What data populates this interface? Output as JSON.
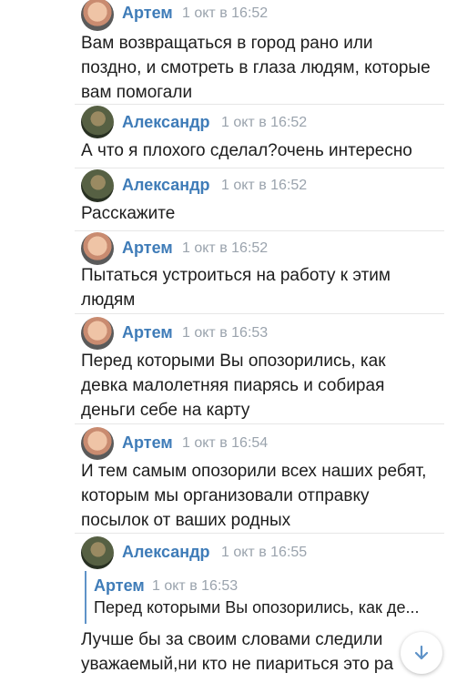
{
  "messages": [
    {
      "author": "Артем",
      "date": "1 окт в 16:52",
      "lines": [
        "Вам возвращаться в город рано или",
        "поздно, и смотреть в глаза людям, которые",
        "вам помогали"
      ]
    },
    {
      "author": "Александр",
      "date": "1 окт в 16:52",
      "lines": [
        "А что я плохого сделал?очень интересно"
      ]
    },
    {
      "author": "Александр",
      "date": "1 окт в 16:52",
      "lines": [
        "Расскажите"
      ]
    },
    {
      "author": "Артем",
      "date": "1 окт в 16:52",
      "lines": [
        "Пытаться устроиться на работу к этим",
        "людям"
      ]
    },
    {
      "author": "Артем",
      "date": "1 окт в 16:53",
      "lines": [
        "Перед которыми Вы опозорились, как",
        "девка малолетняя пиарясь и собирая",
        "деньги себе на карту"
      ]
    },
    {
      "author": "Артем",
      "date": "1 окт в 16:54",
      "lines": [
        "И тем самым опозорили всех наших ребят,",
        "которым мы организовали отправку",
        "посылок от ваших родных"
      ]
    },
    {
      "author": "Александр",
      "date": "1 окт в 16:55",
      "quote": {
        "author": "Артем",
        "date": "1 окт в 16:53",
        "text": "Перед которыми Вы опозорились, как де..."
      },
      "lines": [
        "Лучше бы за своим словами следили",
        "уважаемый,ни кто не пиариться это ра"
      ]
    }
  ]
}
